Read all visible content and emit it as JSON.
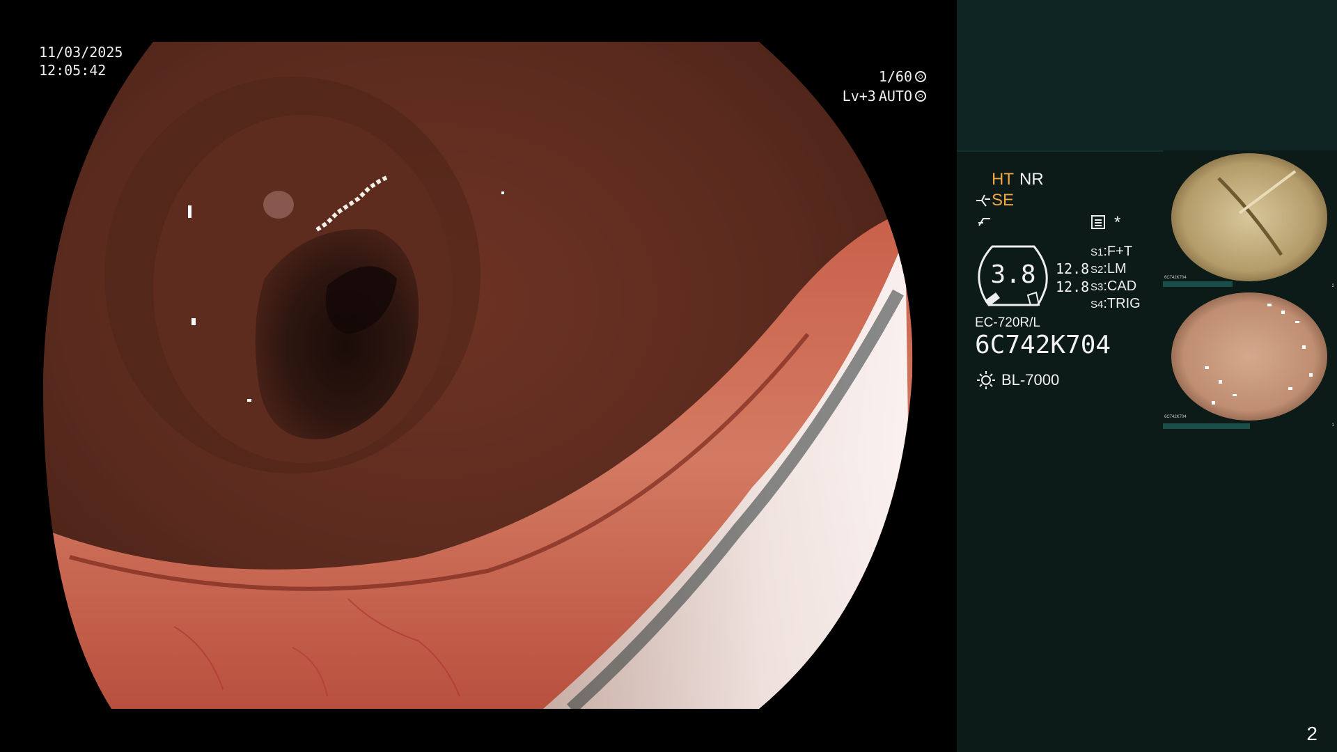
{
  "overlay": {
    "date": "11/03/2025",
    "time": "12:05:42",
    "shutter": "1/60",
    "level": "Lv+3",
    "iris": "AUTO"
  },
  "panel": {
    "ht": "HT",
    "nr": "NR",
    "se": "SE",
    "star": "*",
    "gauge_value": "3.8",
    "value_1": "12.8",
    "value_2": "12.8",
    "switches": [
      {
        "key": "S1",
        "value": "F+T"
      },
      {
        "key": "S2",
        "value": "LM"
      },
      {
        "key": "S3",
        "value": "CAD"
      },
      {
        "key": "S4",
        "value": "TRIG"
      }
    ],
    "scope_model": "EC-720R/L",
    "serial": "6C742K704",
    "light_source": "BL-7000"
  },
  "thumbnails": [
    {
      "label": "6C742K704",
      "index": "2"
    },
    {
      "label": "6C742K704",
      "index": "1"
    }
  ],
  "page_number": "2",
  "colors": {
    "panel_bg": "#0c1a18",
    "panel_top": "#0f2523",
    "accent_orange": "#f0a642"
  }
}
